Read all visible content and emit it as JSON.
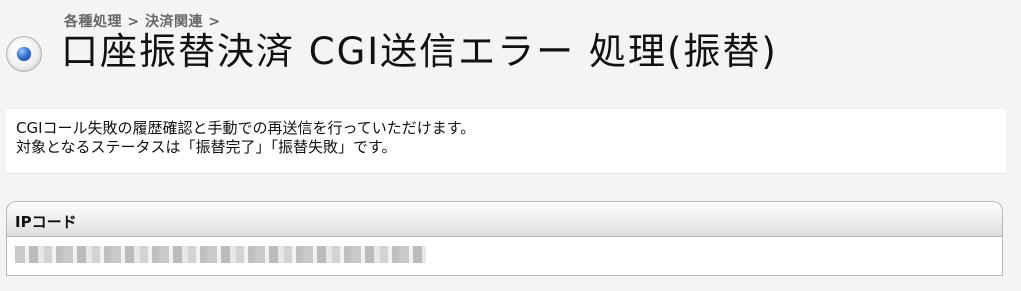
{
  "header": {
    "breadcrumb": "各種処理 > 決済関連 >",
    "title": "口座振替決済 CGI送信エラー 処理(振替)"
  },
  "description": {
    "line1": "CGIコール失敗の履歴確認と手動での再送信を行っていただけます。",
    "line2": "対象となるステータスは「振替完了」「振替失敗」です。"
  },
  "table": {
    "header": "IPコード",
    "row_value_redacted": true
  },
  "colors": {
    "page_background": "#f4f4f4",
    "panel_background": "#ffffff",
    "accent_blue": "#3b79da"
  }
}
